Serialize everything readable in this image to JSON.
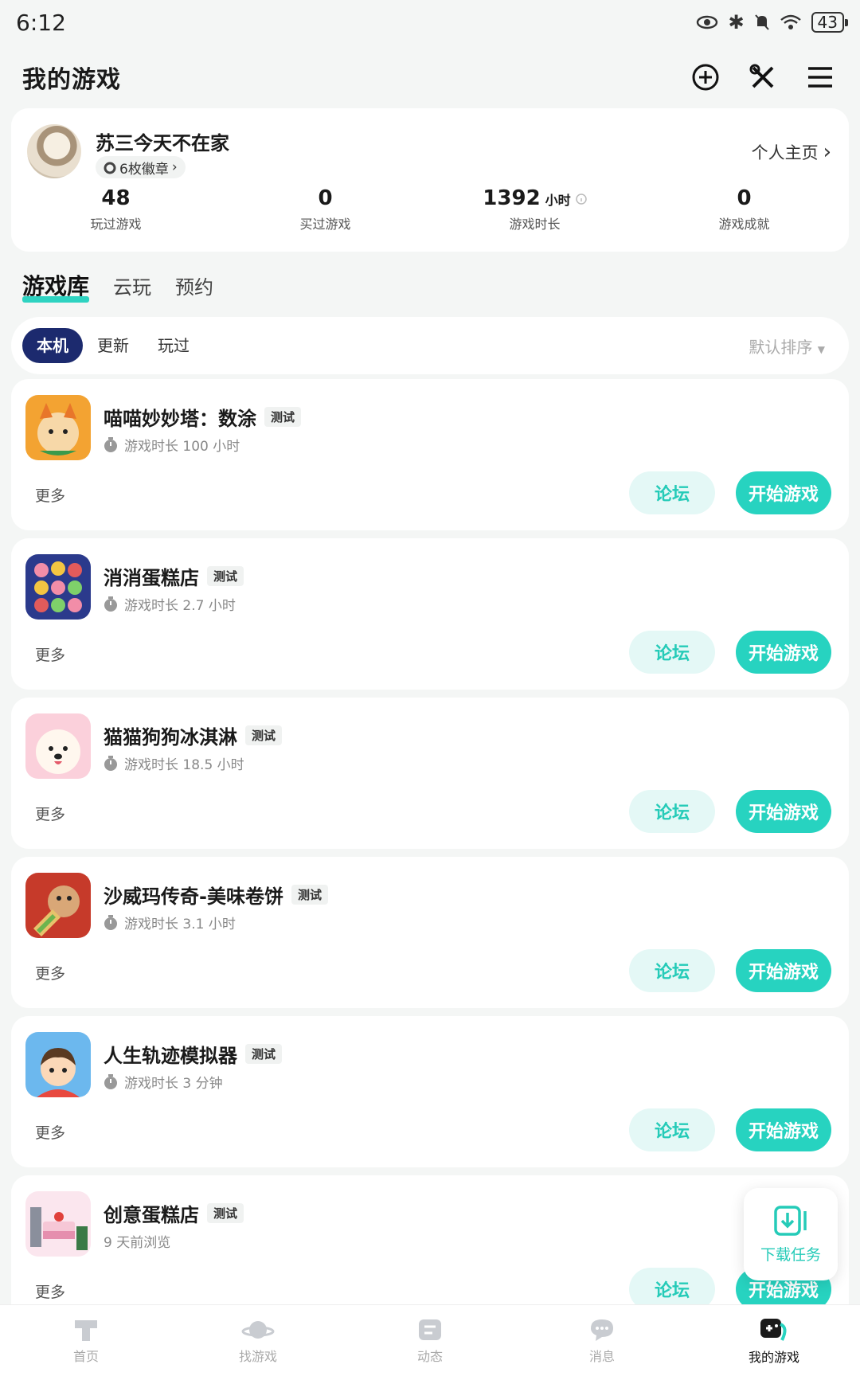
{
  "status_bar": {
    "time": "6:12",
    "battery": "43"
  },
  "header": {
    "title": "我的游戏"
  },
  "profile": {
    "username": "苏三今天不在家",
    "badges": "6枚徽章",
    "homepage_link": "个人主页",
    "stats": [
      {
        "value": "48",
        "unit": "",
        "label": "玩过游戏"
      },
      {
        "value": "0",
        "unit": "",
        "label": "买过游戏"
      },
      {
        "value": "1392",
        "unit": "小时",
        "label": "游戏时长"
      },
      {
        "value": "0",
        "unit": "",
        "label": "游戏成就"
      }
    ]
  },
  "main_tabs": [
    "游戏库",
    "云玩",
    "预约"
  ],
  "filter": {
    "chips": [
      "本机",
      "更新",
      "玩过"
    ],
    "sort": "默认排序"
  },
  "games": [
    {
      "title": "喵喵妙妙塔：数涂",
      "tag": "测试",
      "playtime": "游戏时长 100 小时",
      "icon": "cat-tower-icon"
    },
    {
      "title": "消消蛋糕店",
      "tag": "测试",
      "playtime": "游戏时长 2.7 小时",
      "icon": "cupcake-icon"
    },
    {
      "title": "猫猫狗狗冰淇淋",
      "tag": "测试",
      "playtime": "游戏时长 18.5 小时",
      "icon": "dog-icon"
    },
    {
      "title": "沙威玛传奇-美味卷饼",
      "tag": "测试",
      "playtime": "游戏时长 3.1 小时",
      "icon": "shawarma-icon"
    },
    {
      "title": "人生轨迹模拟器",
      "tag": "测试",
      "playtime": "游戏时长 3 分钟",
      "icon": "life-sim-icon"
    },
    {
      "title": "创意蛋糕店",
      "tag": "测试",
      "playtime": "9 天前浏览",
      "icon": "cake-shop-icon"
    }
  ],
  "card_actions": {
    "more": "更多",
    "forum": "论坛",
    "start": "开始游戏"
  },
  "download_fab": {
    "label": "下载任务"
  },
  "bottom_nav": [
    {
      "label": "首页",
      "icon": "home-icon"
    },
    {
      "label": "找游戏",
      "icon": "planet-icon"
    },
    {
      "label": "动态",
      "icon": "feed-icon"
    },
    {
      "label": "消息",
      "icon": "chat-icon"
    },
    {
      "label": "我的游戏",
      "icon": "gamepad-icon"
    }
  ],
  "colors": {
    "accent": "#27d3c0",
    "accent_light": "#e4f8f6",
    "chip_active": "#1c2a6e"
  }
}
